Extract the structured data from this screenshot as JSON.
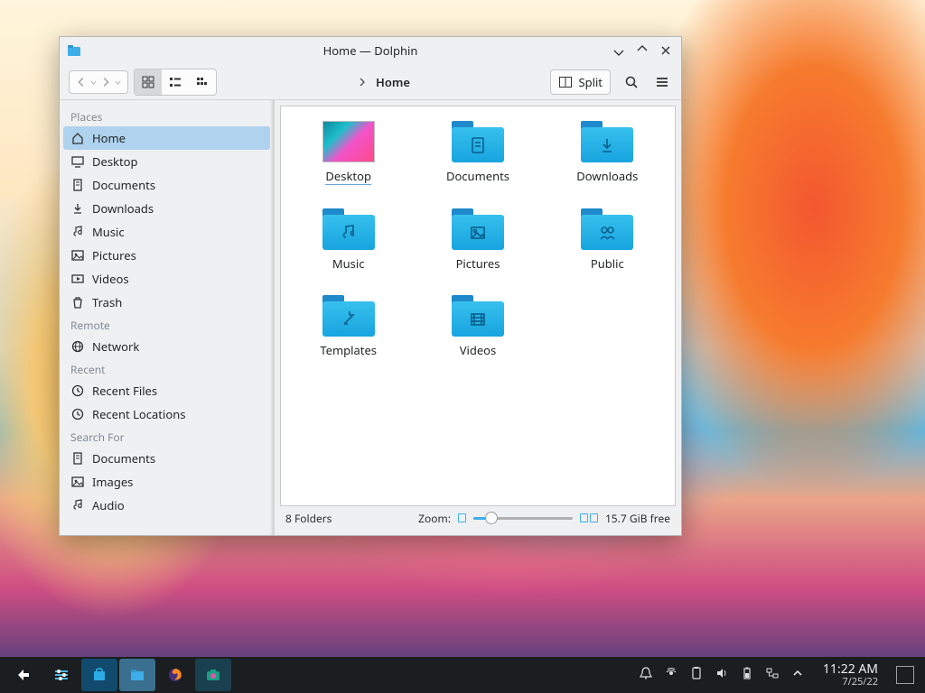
{
  "window": {
    "title": "Home — Dolphin",
    "breadcrumb": "Home",
    "split_label": "Split"
  },
  "sidebar": {
    "sections": [
      {
        "title": "Places",
        "items": [
          {
            "icon": "home",
            "label": "Home",
            "active": true
          },
          {
            "icon": "desktop",
            "label": "Desktop"
          },
          {
            "icon": "documents",
            "label": "Documents"
          },
          {
            "icon": "downloads",
            "label": "Downloads"
          },
          {
            "icon": "music",
            "label": "Music"
          },
          {
            "icon": "pictures",
            "label": "Pictures"
          },
          {
            "icon": "videos",
            "label": "Videos"
          },
          {
            "icon": "trash",
            "label": "Trash"
          }
        ]
      },
      {
        "title": "Remote",
        "items": [
          {
            "icon": "network",
            "label": "Network"
          }
        ]
      },
      {
        "title": "Recent",
        "items": [
          {
            "icon": "clock",
            "label": "Recent Files"
          },
          {
            "icon": "clock",
            "label": "Recent Locations"
          }
        ]
      },
      {
        "title": "Search For",
        "items": [
          {
            "icon": "documents",
            "label": "Documents"
          },
          {
            "icon": "pictures",
            "label": "Images"
          },
          {
            "icon": "music",
            "label": "Audio"
          }
        ]
      }
    ]
  },
  "files": [
    {
      "name": "Desktop",
      "icon": "desktop-thumb",
      "selected": true
    },
    {
      "name": "Documents",
      "icon": "doc"
    },
    {
      "name": "Downloads",
      "icon": "download"
    },
    {
      "name": "Music",
      "icon": "music"
    },
    {
      "name": "Pictures",
      "icon": "picture"
    },
    {
      "name": "Public",
      "icon": "public"
    },
    {
      "name": "Templates",
      "icon": "template"
    },
    {
      "name": "Videos",
      "icon": "video"
    }
  ],
  "status": {
    "count": "8 Folders",
    "zoom_label": "Zoom:",
    "free": "15.7 GiB free"
  },
  "taskbar": {
    "time": "11:22 AM",
    "date": "7/25/22"
  }
}
